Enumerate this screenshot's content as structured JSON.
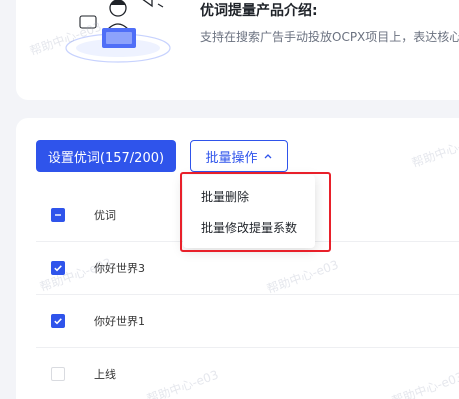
{
  "intro": {
    "title": "优词提量产品介绍:",
    "description": "支持在搜索广告手动投放OCPX项目上，表达核心..."
  },
  "toolbar": {
    "set_button_label": "设置优词(157/200)",
    "batch_button_label": "批量操作"
  },
  "dropdown": {
    "items": [
      "批量删除",
      "批量修改提量系数"
    ]
  },
  "table": {
    "header": "优词",
    "rows": [
      {
        "name": "你好世界3",
        "checked": true
      },
      {
        "name": "你好世界1",
        "checked": true
      },
      {
        "name": "上线",
        "checked": false
      }
    ]
  },
  "watermark": "帮助中心-e03",
  "colors": {
    "primary": "#2f54eb",
    "highlight": "#e8202a",
    "background": "#f3f4f8"
  }
}
